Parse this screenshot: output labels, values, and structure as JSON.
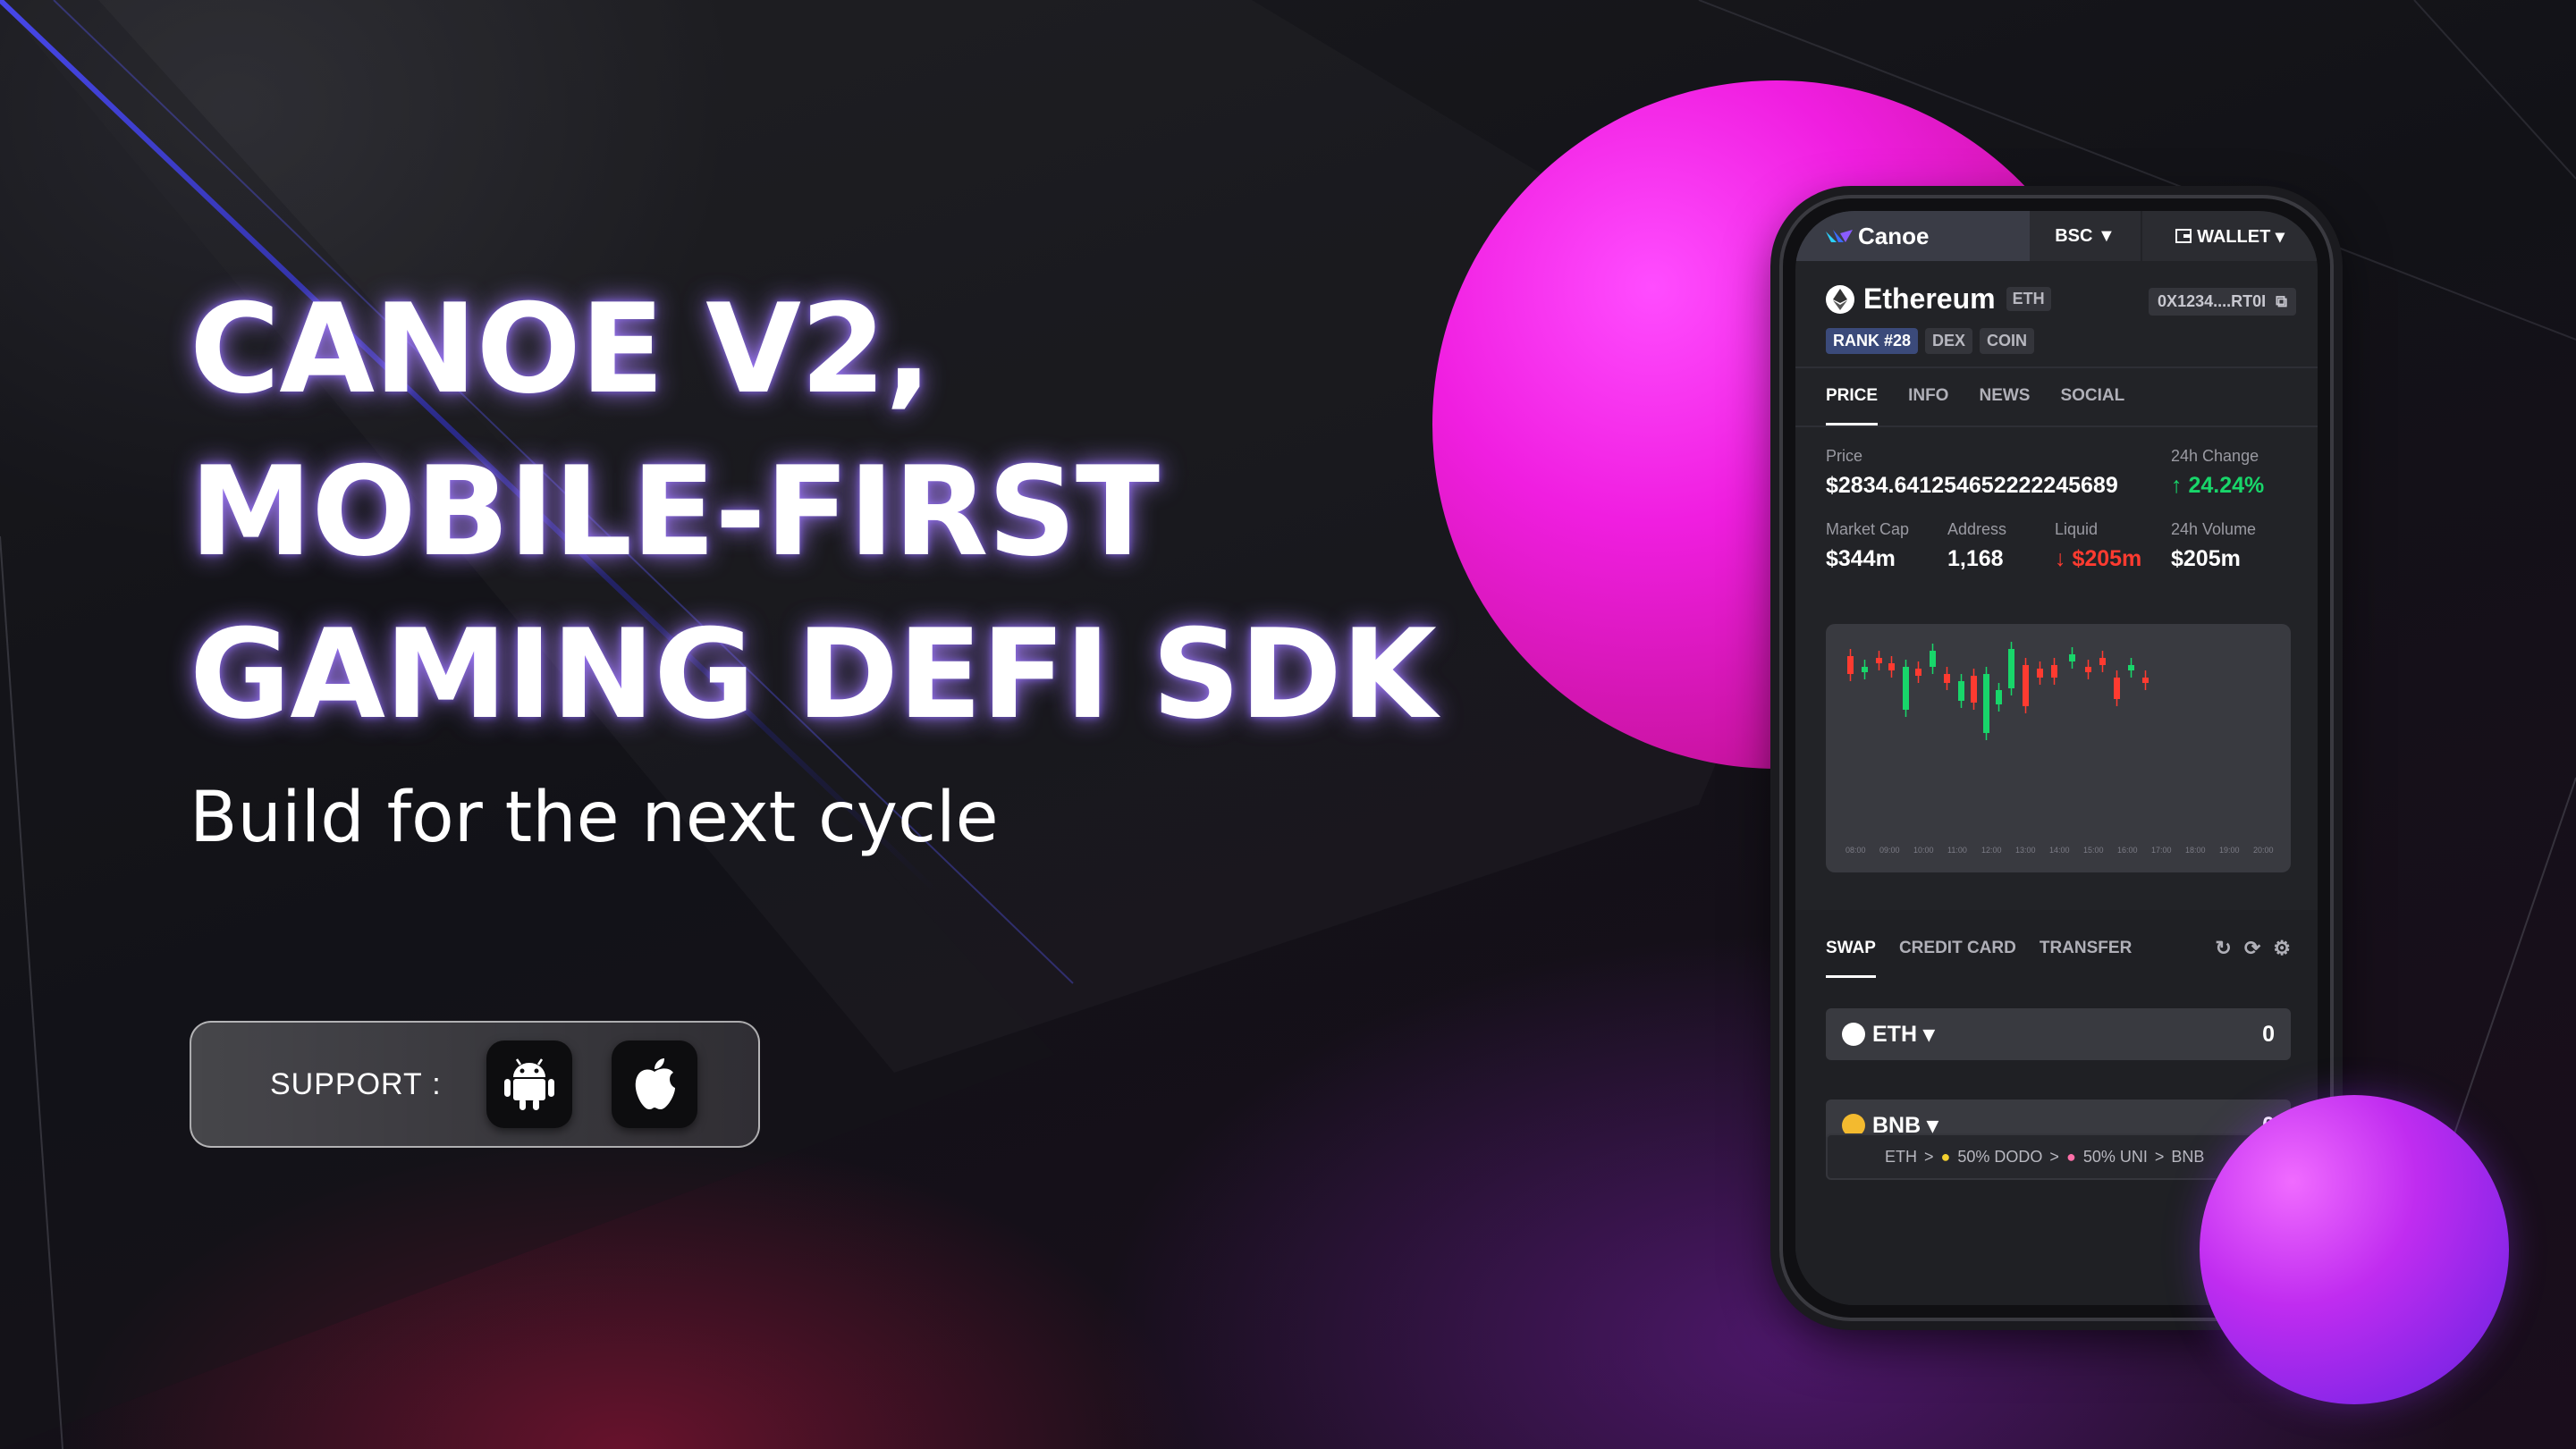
{
  "hero": {
    "headline": [
      "CANOE V2,",
      "MOBILE-FIRST",
      "GAMING DEFI SDK"
    ],
    "subtitle": "Build for the next cycle",
    "support_label": "SUPPORT :",
    "platforms": [
      "android-icon",
      "apple-icon"
    ]
  },
  "app": {
    "brand": "Canoe",
    "chain": "BSC ▼",
    "wallet": "WALLET ▾",
    "token": {
      "name": "Ethereum",
      "symbol": "ETH",
      "address": "0X1234....RT0I",
      "tags": [
        "RANK #28",
        "DEX",
        "COIN"
      ]
    },
    "tabs": [
      "PRICE",
      "INFO",
      "NEWS",
      "SOCIAL"
    ],
    "stats": {
      "price_label": "Price",
      "price_value": "$2834.641254652222245689",
      "change_label": "24h Change",
      "change_value": "↑ 24.24%",
      "market_cap_label": "Market Cap",
      "market_cap_value": "$344m",
      "address_label": "Address",
      "address_value": "1,168",
      "liquid_label": "Liquid",
      "liquid_value": "↓ $205m",
      "volume_label": "24h Volume",
      "volume_value": "$205m"
    },
    "chart_ticks": [
      "08:00",
      "09:00",
      "10:00",
      "11:00",
      "12:00",
      "13:00",
      "14:00",
      "15:00",
      "16:00",
      "17:00",
      "18:00",
      "19:00",
      "20:00"
    ],
    "swap": {
      "tabs": [
        "SWAP",
        "CREDIT CARD",
        "TRANSFER"
      ],
      "from_token": "ETH ▾",
      "from_amount": "0",
      "to_token": "BNB ▾",
      "to_amount": "0",
      "route": [
        "ETH",
        ">",
        "50% DODO",
        ">",
        "50% UNI",
        ">",
        "BNB"
      ]
    }
  },
  "colors": {
    "up": "#18d66a",
    "down": "#ff3b30",
    "sphere": "#f01ee0"
  }
}
